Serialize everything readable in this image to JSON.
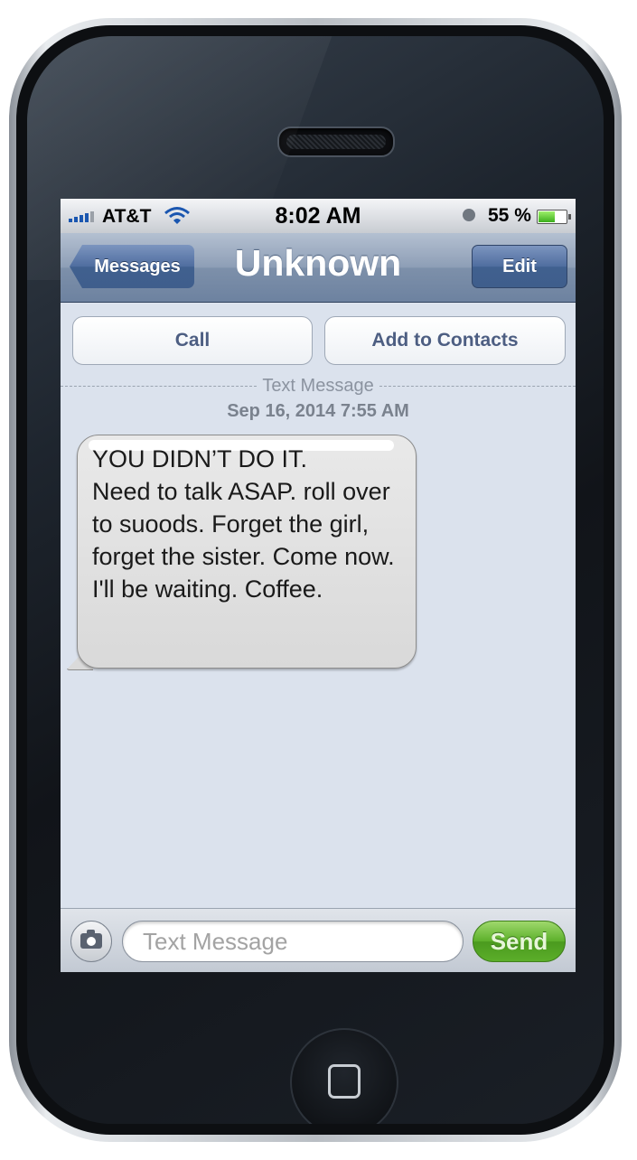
{
  "status_bar": {
    "carrier": "AT&T",
    "time": "8:02 AM",
    "battery_percent": "55 %",
    "battery_level": 0.55,
    "icons": [
      "signal-bars-icon",
      "wifi-icon",
      "clock-icon",
      "battery-icon"
    ]
  },
  "nav": {
    "back_label": "Messages",
    "title": "Unknown",
    "edit_label": "Edit"
  },
  "actions": {
    "call_label": "Call",
    "add_contact_label": "Add to Contacts"
  },
  "thread": {
    "divider_label": "Text Message",
    "timestamp": "Sep 16, 2014 7:55 AM",
    "messages": [
      {
        "direction": "incoming",
        "text": "YOU DIDN’T DO IT.\nNeed to talk ASAP. roll over to suoods. Forget the girl, forget the sister. Come now. I'll be waiting. Coffee."
      }
    ]
  },
  "compose": {
    "placeholder": "Text Message",
    "value": "",
    "send_label": "Send"
  },
  "colors": {
    "nav_bar": "#8d9eb6",
    "send_green": "#5cb02a",
    "bubble_gray": "#dadada",
    "screen_bg": "#dbe2ed"
  }
}
